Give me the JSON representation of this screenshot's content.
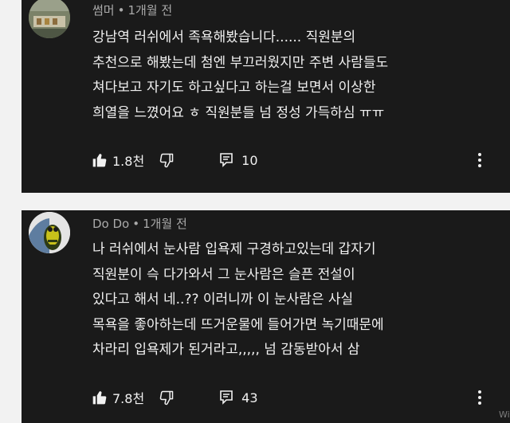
{
  "comments": [
    {
      "author": "썸머",
      "time": "1개월 전",
      "text": "강남역 러쉬에서 족욕해봤습니다...... 직원분의\n추천으로 해봤는데 첨엔 부끄러웠지만 주변 사람들도\n쳐다보고 자기도 하고싶다고 하는걸 보면서 이상한\n희열을 느꼈어요 ㅎ 직원분들 넘 정성 가득하심 ㅠㅠ",
      "likes": "1.8천",
      "replies": "10"
    },
    {
      "author": "Do Do",
      "time": "1개월 전",
      "text": "나 러쉬에서 눈사람 입욕제 구경하고있는데 갑자기\n직원분이 슥 다가와서 그 눈사람은 슬픈 전설이\n있다고 해서 네..?? 이러니까 이 눈사람은 사실\n목욕을 좋아하는데 뜨거운물에 들어가면 녹기때문에\n차라리 입욕제가 된거라고,,,,, 넘 감동받아서 삼",
      "likes": "7.8천",
      "replies": "43"
    }
  ],
  "separator": "•",
  "watermark": "Wi"
}
